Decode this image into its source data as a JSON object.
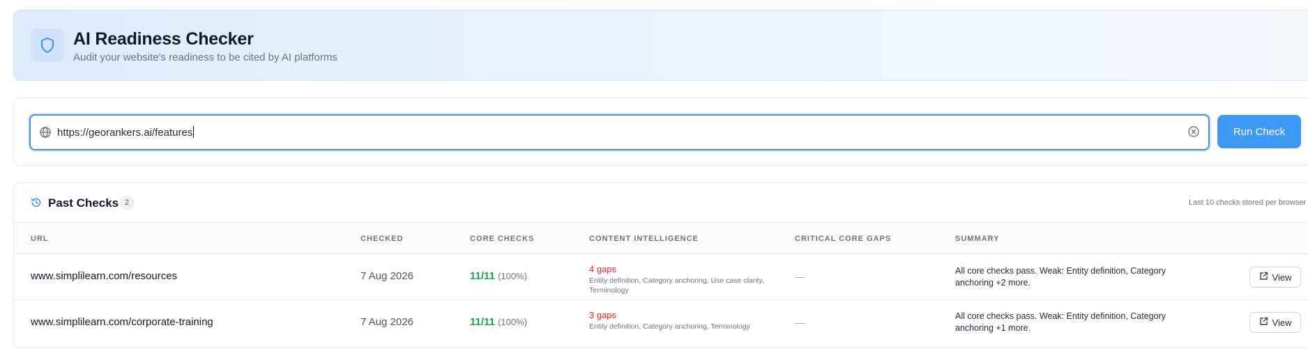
{
  "header": {
    "title": "AI Readiness Checker",
    "subtitle": "Audit your website's readiness to be cited by AI platforms",
    "icon": "shield-icon"
  },
  "input": {
    "value": "https://georankers.ai/features",
    "icon": "globe-icon",
    "clear_icon": "clear-icon",
    "run_label": "Run Check"
  },
  "past": {
    "title": "Past Checks",
    "count": "2",
    "note": "Last 10 checks stored per browser",
    "columns": {
      "url": "URL",
      "checked": "CHECKED",
      "core": "CORE CHECKS",
      "content": "CONTENT INTELLIGENCE",
      "critical": "CRITICAL CORE GAPS",
      "summary": "SUMMARY"
    },
    "rows": [
      {
        "url": "www.simplilearn.com/resources",
        "checked": "7 Aug 2026",
        "core": "11/11",
        "core_pct": "(100%)",
        "gaps": "4 gaps",
        "gap_list": "Entity definition, Category anchoring, Use case clarity, Terminology",
        "critical": "—",
        "summary": "All core checks pass. Weak: Entity definition, Category anchoring +2 more.",
        "view_label": "View"
      },
      {
        "url": "www.simplilearn.com/corporate-training",
        "checked": "7 Aug 2026",
        "core": "11/11",
        "core_pct": "(100%)",
        "gaps": "3 gaps",
        "gap_list": "Entity definition, Category anchoring, Terminology",
        "critical": "—",
        "summary": "All core checks pass. Weak: Entity definition, Category anchoring +1 more.",
        "view_label": "View"
      }
    ]
  },
  "colors": {
    "accent": "#3d99f5",
    "success": "#16a34a",
    "danger": "#dc2626"
  }
}
